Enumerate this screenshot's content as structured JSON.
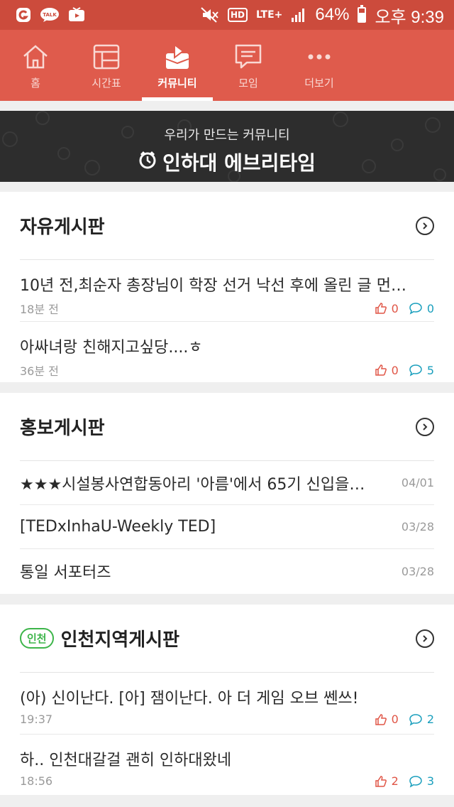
{
  "status_bar": {
    "battery": "64%",
    "time": "오후 9:39",
    "network": "LTE+",
    "hd": "HD",
    "talk": "TALK",
    "icons": [
      "g-app-icon",
      "kakaotalk-icon",
      "kakao-tv-icon",
      "mute-icon",
      "hd-icon",
      "lte-icon",
      "signal-icon",
      "battery-icon"
    ]
  },
  "tabs": [
    {
      "label": "홈",
      "icon": "home-icon",
      "active": false
    },
    {
      "label": "시간표",
      "icon": "timetable-icon",
      "active": false
    },
    {
      "label": "커뮤니티",
      "icon": "community-icon",
      "active": true
    },
    {
      "label": "모임",
      "icon": "chat-icon",
      "active": false
    },
    {
      "label": "더보기",
      "icon": "more-icon",
      "active": false
    }
  ],
  "banner": {
    "subtitle": "우리가 만드는 커뮤니티",
    "title": "인하대 에브리타임"
  },
  "free_board": {
    "title": "자유게시판",
    "posts": [
      {
        "title": "10년 전,최순자 총장님이 학장 선거 낙선 후에 올린 글 먼…",
        "time": "18분 전",
        "likes": "0",
        "comments": "0"
      },
      {
        "title": "아싸녀랑 친해지고싶당....ㅎ",
        "time": "36분 전",
        "likes": "0",
        "comments": "5"
      }
    ]
  },
  "promo_board": {
    "title": "홍보게시판",
    "posts": [
      {
        "title": "★★★시설봉사연합동아리 '아름'에서 65기 신입을…",
        "date": "04/01"
      },
      {
        "title": "[TEDxInhaU-Weekly TED]",
        "date": "03/28"
      },
      {
        "title": "통일 서포터즈",
        "date": "03/28"
      }
    ]
  },
  "region_board": {
    "badge": "인천",
    "title": "인천지역게시판",
    "posts": [
      {
        "title": "(아) 신이난다. [아] 잼이난다. 아 더 게임 오브 쎈쓰!",
        "time": "19:37",
        "likes": "0",
        "comments": "2"
      },
      {
        "title": "하.. 인천대갈걸 괜히 인하대왔네",
        "time": "18:56",
        "likes": "2",
        "comments": "3"
      }
    ]
  },
  "colors": {
    "status_bar": "#cc4b3c",
    "tab_bar": "#df5b4c",
    "banner": "#2d2d2d",
    "like": "#e05546",
    "comment": "#1a9fbd",
    "region_badge": "#3db54a"
  }
}
